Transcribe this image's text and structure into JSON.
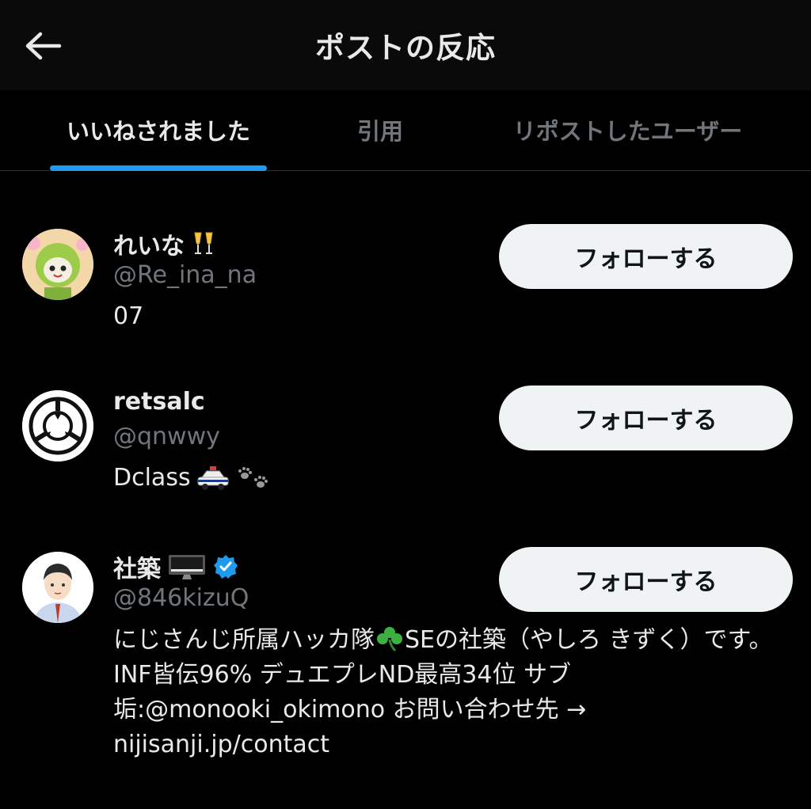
{
  "header": {
    "title": "ポストの反応",
    "back_icon": "arrow-left-icon"
  },
  "tabs": [
    {
      "label": "いいねされました",
      "active": true
    },
    {
      "label": "引用",
      "active": false
    },
    {
      "label": "リポストしたユーザー",
      "active": false
    }
  ],
  "users": [
    {
      "name": "れいな",
      "name_emoji": "champagne-glasses-icon",
      "handle": "@Re_ina_na",
      "bio": "07",
      "follow_label": "フォローする",
      "verified": false
    },
    {
      "name": "retsalc",
      "handle": "@qnwwy",
      "bio": "Dclass",
      "bio_emojis": [
        "police-car-icon",
        "paw-prints-icon"
      ],
      "follow_label": "フォローする",
      "verified": false
    },
    {
      "name": "社築",
      "name_emoji": "desktop-computer-icon",
      "handle": "@846kizuQ",
      "bio_part1": "にじさんじ所属ハッカ隊",
      "bio_part2": "SEの社築（やしろ きずく）です。INF皆伝96% デュエプレND最高34位 サブ垢:@monooki_okimono お問い合わせ先 → nijisanji.jp/contact",
      "bio_emoji": "shamrock-icon",
      "follow_label": "フォローする",
      "verified": true
    }
  ],
  "colors": {
    "accent": "#1d9bf0",
    "background": "#000000",
    "secondary_text": "#71767b",
    "button_bg": "#eff3f4"
  }
}
